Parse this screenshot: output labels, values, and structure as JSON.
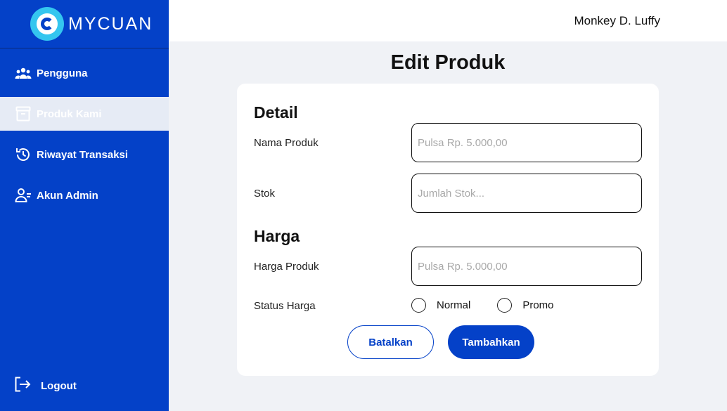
{
  "brand": {
    "name": "MYCUAN"
  },
  "sidebar": {
    "items": [
      {
        "label": "Pengguna",
        "icon": "users-icon"
      },
      {
        "label": "Produk Kami",
        "icon": "archive-box-icon",
        "active": true
      },
      {
        "label": "Riwayat Transaksi",
        "icon": "history-icon"
      },
      {
        "label": "Akun Admin",
        "icon": "user-admin-icon"
      }
    ],
    "logout_label": "Logout"
  },
  "header": {
    "user_name": "Monkey D. Luffy"
  },
  "main": {
    "title": "Edit Produk",
    "detail_title": "Detail",
    "harga_title": "Harga",
    "fields": {
      "nama_produk": {
        "label": "Nama Produk",
        "placeholder": "Pulsa Rp. 5.000,00"
      },
      "stok": {
        "label": "Stok",
        "placeholder": "Jumlah Stok..."
      },
      "harga_produk": {
        "label": "Harga Produk",
        "placeholder": "Pulsa Rp. 5.000,00"
      }
    },
    "status_harga": {
      "label": "Status Harga",
      "options": [
        "Normal",
        "Promo"
      ]
    },
    "buttons": {
      "cancel": "Batalkan",
      "submit": "Tambahkan"
    }
  },
  "colors": {
    "primary": "#0441c8",
    "logo_accent": "#34c6ef",
    "background": "#f0f2f6"
  }
}
